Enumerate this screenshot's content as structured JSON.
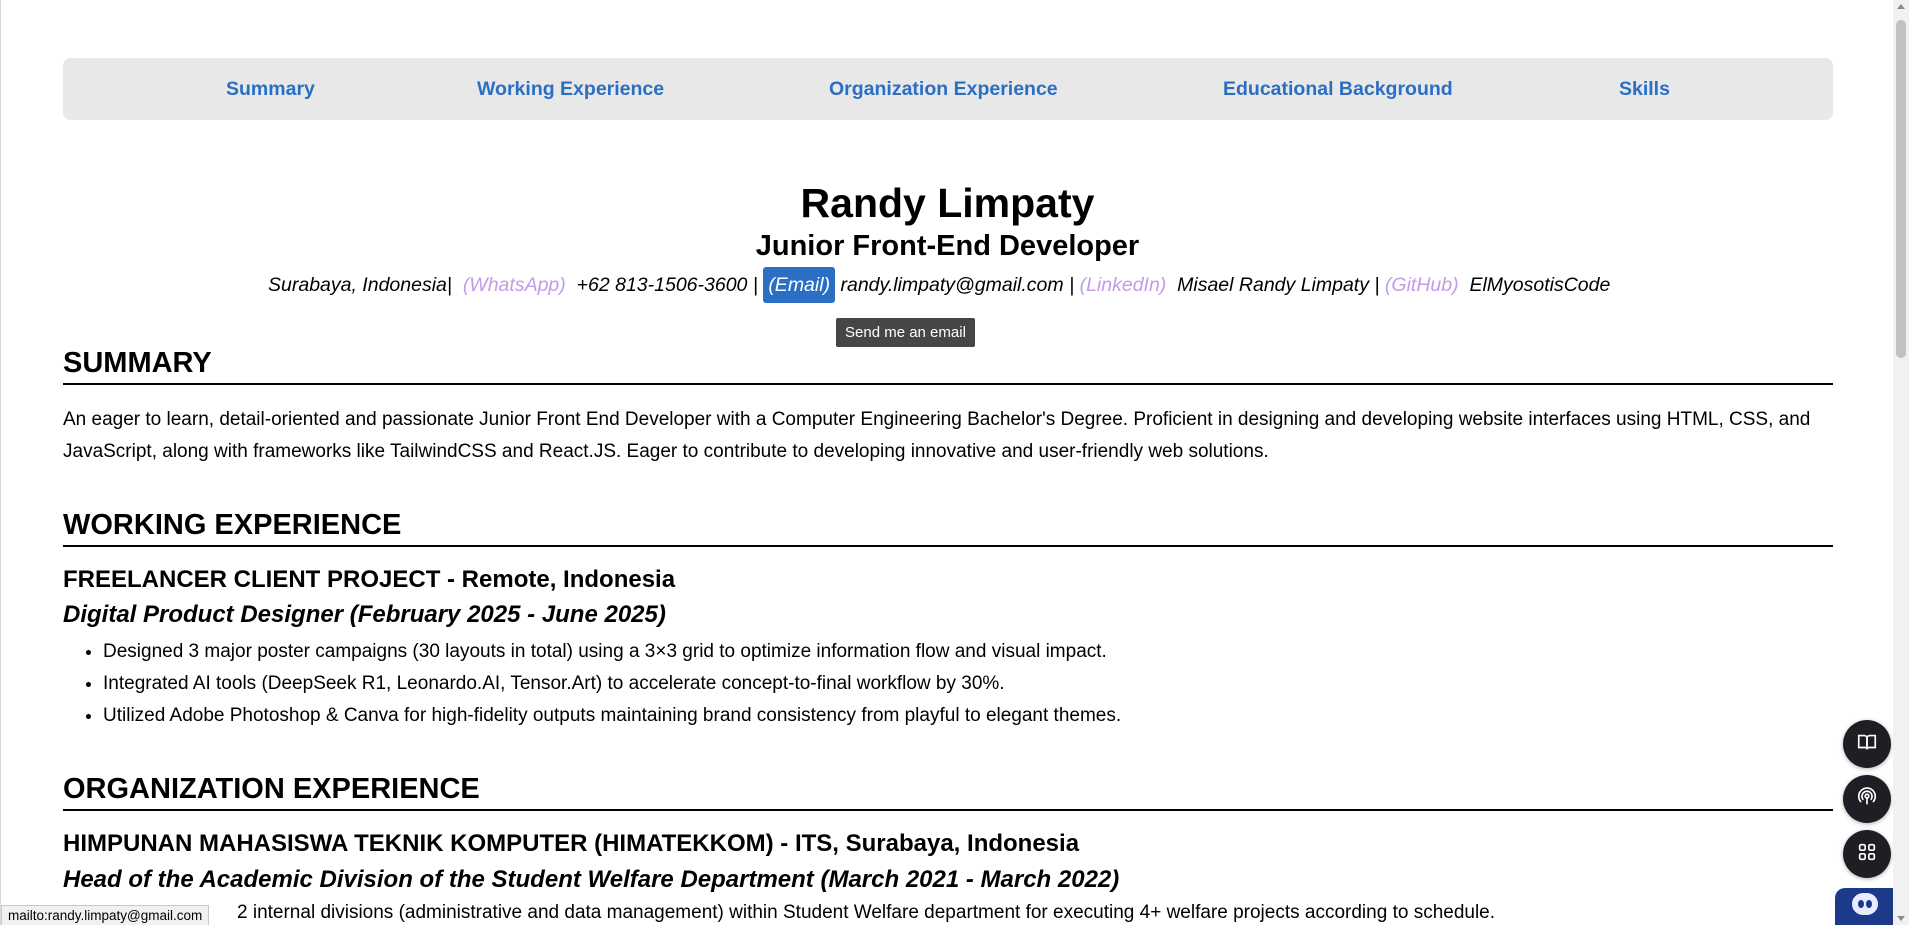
{
  "nav": {
    "items": [
      {
        "label": "Summary"
      },
      {
        "label": "Working Experience"
      },
      {
        "label": "Organization Experience"
      },
      {
        "label": "Educational Background"
      },
      {
        "label": "Skills"
      }
    ]
  },
  "header": {
    "name": "Randy Limpaty",
    "role": "Junior Front-End Developer",
    "location": "Surabaya, Indonesia",
    "sep": "|",
    "whatsapp_label": "(WhatsApp)",
    "phone": "+62 813-1506-3600",
    "email_label": "(Email)",
    "email": "randy.limpaty@gmail.com",
    "linkedin_label": "(LinkedIn)",
    "linkedin": "Misael Randy Limpaty",
    "github_label": "(GitHub)",
    "github": "ElMyosotisCode"
  },
  "tooltip": "Send me an email",
  "summary": {
    "title": "SUMMARY",
    "text": "An eager to learn, detail-oriented and passionate Junior Front End Developer with a Computer Engineering Bachelor's Degree. Proficient in designing and developing website interfaces using HTML, CSS, and JavaScript, along with frameworks like TailwindCSS and React.JS. Eager to contribute to developing innovative and user-friendly web solutions."
  },
  "work": {
    "title": "WORKING EXPERIENCE",
    "company": "FREELANCER CLIENT PROJECT - Remote, Indonesia",
    "position": "Digital Product Designer (February 2025 - June 2025)",
    "bullets": [
      "Designed 3 major poster campaigns (30 layouts in total) using a 3×3 grid to optimize information flow and visual impact.",
      "Integrated AI tools (DeepSeek R1, Leonardo.AI, Tensor.Art) to accelerate concept-to-final workflow by 30%.",
      "Utilized Adobe Photoshop & Canva for high-fidelity outputs maintaining brand consistency from playful to elegant themes."
    ]
  },
  "org": {
    "title": "ORGANIZATION EXPERIENCE",
    "company": "HIMPUNAN MAHASISWA TEKNIK KOMPUTER (HIMATEKKOM) - ITS, Surabaya, Indonesia",
    "position": "Head of the Academic Division of the Student Welfare Department (March 2021 - March 2022)",
    "partial_bullet": "2 internal divisions (administrative and data management) within Student Welfare department for executing 4+ welfare projects according to schedule."
  },
  "status_bar": "mailto:randy.limpaty@gmail.com",
  "fabs": [
    "book-icon",
    "broadcast-icon",
    "apps-grid-icon",
    "assistant-icon"
  ]
}
